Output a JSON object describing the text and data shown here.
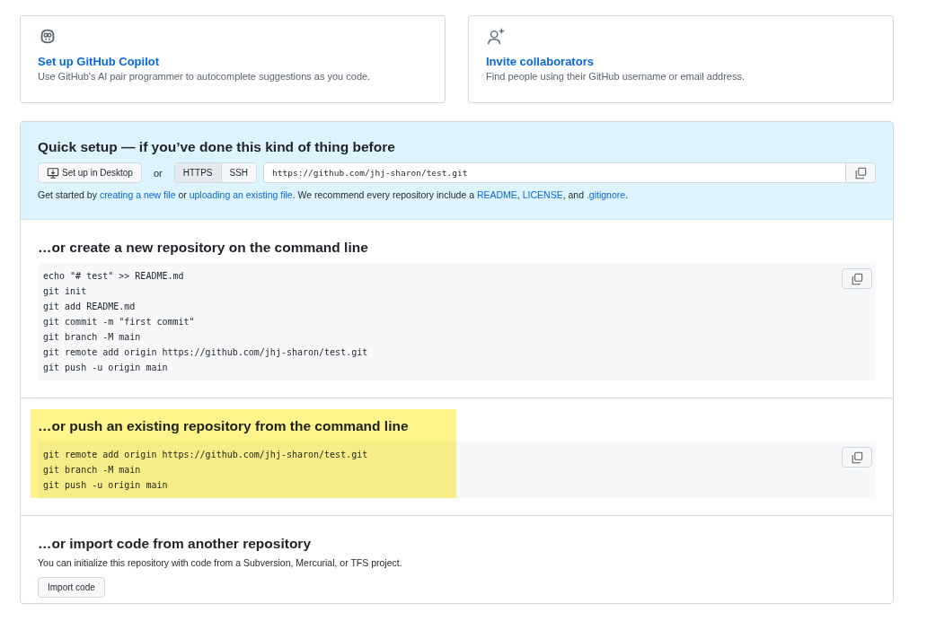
{
  "cards": [
    {
      "kind": "copilot",
      "title": "Set up GitHub Copilot",
      "description": "Use GitHub's AI pair programmer to autocomplete suggestions as you code."
    },
    {
      "kind": "invite",
      "title": "Invite collaborators",
      "description": "Find people using their GitHub username or email address."
    }
  ],
  "quick_setup": {
    "title": "Quick setup — if you’ve done this kind of thing before",
    "desktop_button": "Set up in Desktop",
    "or": "or",
    "protocols": [
      {
        "label": "HTTPS",
        "selected": true
      },
      {
        "label": "SSH",
        "selected": false
      }
    ],
    "url": "https://github.com/jhj-sharon/test.git",
    "hint": [
      {
        "kind": "text",
        "text": "Get started by "
      },
      {
        "kind": "link",
        "text": "creating a new file"
      },
      {
        "kind": "text",
        "text": " or "
      },
      {
        "kind": "link",
        "text": "uploading an existing file"
      },
      {
        "kind": "text",
        "text": ". We recommend every repository include a "
      },
      {
        "kind": "link",
        "text": "README"
      },
      {
        "kind": "text",
        "text": ", "
      },
      {
        "kind": "link",
        "text": "LICENSE"
      },
      {
        "kind": "text",
        "text": ", and "
      },
      {
        "kind": "link",
        "text": ".gitignore"
      },
      {
        "kind": "text",
        "text": "."
      }
    ]
  },
  "sections": [
    {
      "kind": "code",
      "title": "…or create a new repository on the command line",
      "highlighted": false,
      "lines": [
        "echo \"# test\" >> README.md",
        "git init",
        "git add README.md",
        "git commit -m \"first commit\"",
        "git branch -M main",
        "git remote add origin https://github.com/jhj-sharon/test.git",
        "git push -u origin main"
      ]
    },
    {
      "kind": "code",
      "title": "…or push an existing repository from the command line",
      "highlighted": true,
      "lines": [
        "git remote add origin https://github.com/jhj-sharon/test.git",
        "git branch -M main",
        "git push -u origin main"
      ]
    },
    {
      "kind": "import",
      "title": "…or import code from another repository",
      "highlighted": false,
      "description": "You can initialize this repository with code from a Subversion, Mercurial, or TFS project.",
      "button": "Import code"
    }
  ]
}
